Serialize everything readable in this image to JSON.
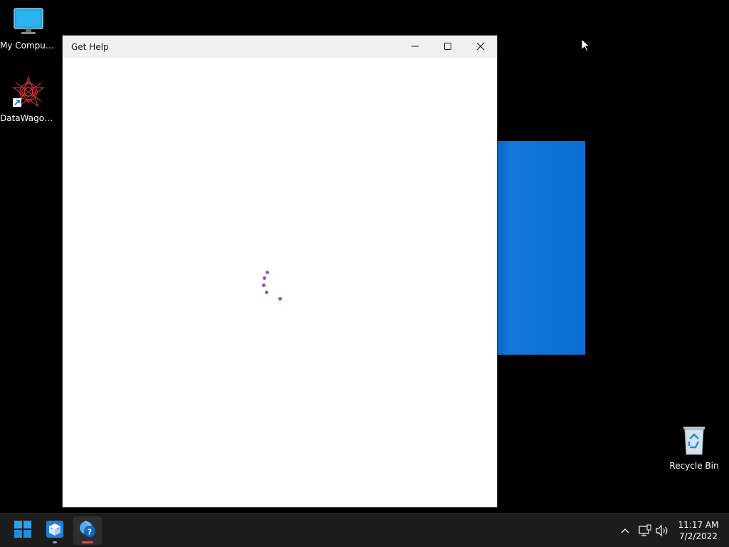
{
  "desktop": {
    "icons": [
      {
        "label": "My Computer",
        "icon": "monitor-icon"
      },
      {
        "label": "DataWagon...",
        "icon": "datawagon-icon"
      },
      {
        "label": "Recycle Bin",
        "icon": "recycle-bin-icon"
      }
    ],
    "background_color": "#000000"
  },
  "window": {
    "title": "Get Help",
    "controls": [
      "minimize-icon",
      "maximize-icon",
      "close-icon"
    ],
    "state": "loading",
    "spinner_color": "#a44cc0"
  },
  "taskbar": {
    "apps": [
      {
        "name": "start",
        "icon": "windows-logo-icon"
      },
      {
        "name": "app",
        "icon": "package-icon"
      },
      {
        "name": "get-help",
        "icon": "get-help-icon",
        "active": true
      }
    ],
    "tray": {
      "icons": [
        "chevron-up-icon",
        "network-icon",
        "volume-icon"
      ],
      "time": "11:17 AM",
      "date": "7/2/2022"
    }
  }
}
